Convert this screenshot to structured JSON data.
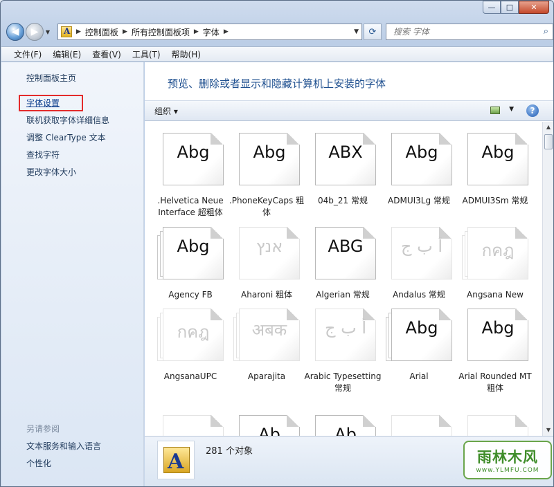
{
  "window": {
    "minimize": "—",
    "maximize": "□",
    "close": "✕"
  },
  "nav": {
    "back_glyph": "◀",
    "forward_glyph": "▶",
    "breadcrumbs": [
      "控制面板",
      "所有控制面板项",
      "字体"
    ],
    "refresh_glyph": "⟳",
    "search_placeholder": "搜索 字体"
  },
  "menu": [
    "文件(F)",
    "编辑(E)",
    "查看(V)",
    "工具(T)",
    "帮助(H)"
  ],
  "sidebar": {
    "home": "控制面板主页",
    "links": [
      "字体设置",
      "联机获取字体详细信息",
      "调整 ClearType 文本",
      "查找字符",
      "更改字体大小"
    ],
    "see_also_title": "另请参阅",
    "see_also": [
      "文本服务和输入语言",
      "个性化"
    ]
  },
  "main": {
    "heading": "预览、删除或者显示和隐藏计算机上安装的字体",
    "organize": "组织 ▾",
    "help": "?"
  },
  "fonts": [
    {
      "name": ".Helvetica Neue Interface 超粗体",
      "sample": "Abg",
      "stack": false,
      "faded": false,
      "icon": "font-icon"
    },
    {
      "name": ".PhoneKeyCaps 粗体",
      "sample": "Abg",
      "stack": false,
      "faded": false,
      "icon": "font-icon"
    },
    {
      "name": "04b_21 常规",
      "sample": "ABX",
      "stack": false,
      "faded": false,
      "icon": "font-icon"
    },
    {
      "name": "ADMUI3Lg 常规",
      "sample": "Abg",
      "stack": false,
      "faded": false,
      "icon": "font-icon"
    },
    {
      "name": "ADMUI3Sm 常规",
      "sample": "Abg",
      "stack": false,
      "faded": false,
      "icon": "font-icon"
    },
    {
      "name": "Agency FB",
      "sample": "Abg",
      "stack": true,
      "faded": false,
      "icon": "font-family-icon"
    },
    {
      "name": "Aharoni 粗体",
      "sample": "אנץ",
      "stack": false,
      "faded": true,
      "icon": "font-icon"
    },
    {
      "name": "Algerian 常规",
      "sample": "ABG",
      "stack": false,
      "faded": false,
      "icon": "font-icon"
    },
    {
      "name": "Andalus 常规",
      "sample": "أ ب ج",
      "stack": false,
      "faded": true,
      "icon": "font-icon"
    },
    {
      "name": "Angsana New",
      "sample": "กคฎ",
      "stack": true,
      "faded": true,
      "icon": "font-family-icon"
    },
    {
      "name": "AngsanaUPC",
      "sample": "กคฎ",
      "stack": true,
      "faded": true,
      "icon": "font-family-icon"
    },
    {
      "name": "Aparajita",
      "sample": "अबक",
      "stack": true,
      "faded": true,
      "icon": "font-family-icon"
    },
    {
      "name": "Arabic Typesetting 常规",
      "sample": "أ ب ج",
      "stack": false,
      "faded": true,
      "icon": "font-icon"
    },
    {
      "name": "Arial",
      "sample": "Abg",
      "stack": true,
      "faded": false,
      "icon": "font-family-icon"
    },
    {
      "name": "Arial Rounded MT 粗体",
      "sample": "Abg",
      "stack": false,
      "faded": false,
      "icon": "font-icon"
    },
    {
      "name": "",
      "sample": "",
      "stack": false,
      "faded": true,
      "icon": "font-icon"
    },
    {
      "name": "",
      "sample": "Ab",
      "stack": false,
      "faded": false,
      "icon": "font-icon"
    },
    {
      "name": "",
      "sample": "Ab",
      "stack": false,
      "faded": false,
      "icon": "font-icon"
    },
    {
      "name": "",
      "sample": "",
      "stack": false,
      "faded": true,
      "icon": "font-icon"
    },
    {
      "name": "",
      "sample": "",
      "stack": false,
      "faded": true,
      "icon": "font-icon"
    }
  ],
  "details": {
    "count_text": "281 个对象",
    "icon": "fonts-folder-icon",
    "letter": "A"
  },
  "watermark": {
    "title": "雨林木风",
    "url": "www.YLMFU.COM"
  }
}
